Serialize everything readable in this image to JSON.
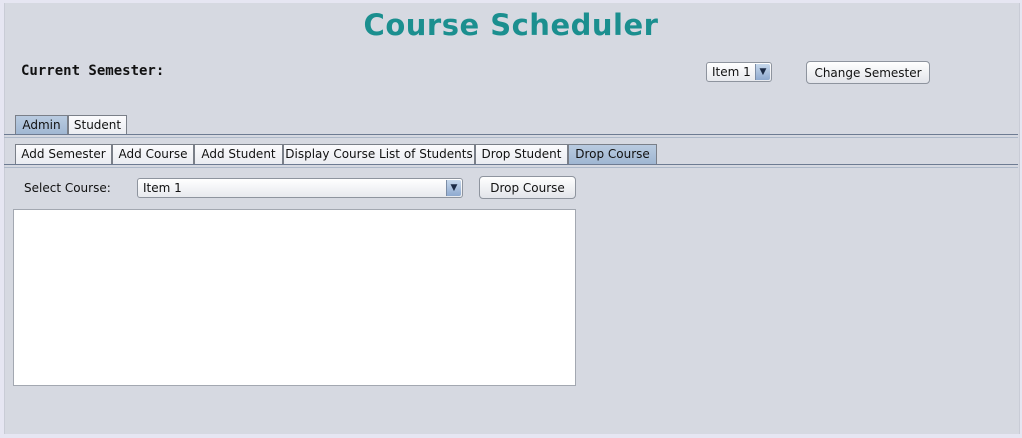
{
  "app": {
    "title": "Course Scheduler"
  },
  "header": {
    "current_semester_label": "Current Semester:",
    "semester_select_value": "Item 1",
    "change_semester_label": "Change Semester"
  },
  "main_tabs": [
    {
      "label": "Admin",
      "selected": true
    },
    {
      "label": "Student",
      "selected": false
    }
  ],
  "admin_tabs": [
    {
      "label": "Add Semester",
      "selected": false
    },
    {
      "label": "Add Course",
      "selected": false
    },
    {
      "label": "Add Student",
      "selected": false
    },
    {
      "label": "Display Course List of Students",
      "selected": false
    },
    {
      "label": "Drop Student",
      "selected": false
    },
    {
      "label": "Drop Course",
      "selected": true
    }
  ],
  "drop_course_panel": {
    "select_label": "Select Course:",
    "course_select_value": "Item 1",
    "drop_button_label": "Drop Course",
    "output_text": ""
  },
  "icons": {
    "dropdown_arrow": "chevron-down-icon"
  },
  "colors": {
    "title": "#1b8f8f",
    "background": "#d6d9e1",
    "selected_tab": "#9fb6d2"
  }
}
